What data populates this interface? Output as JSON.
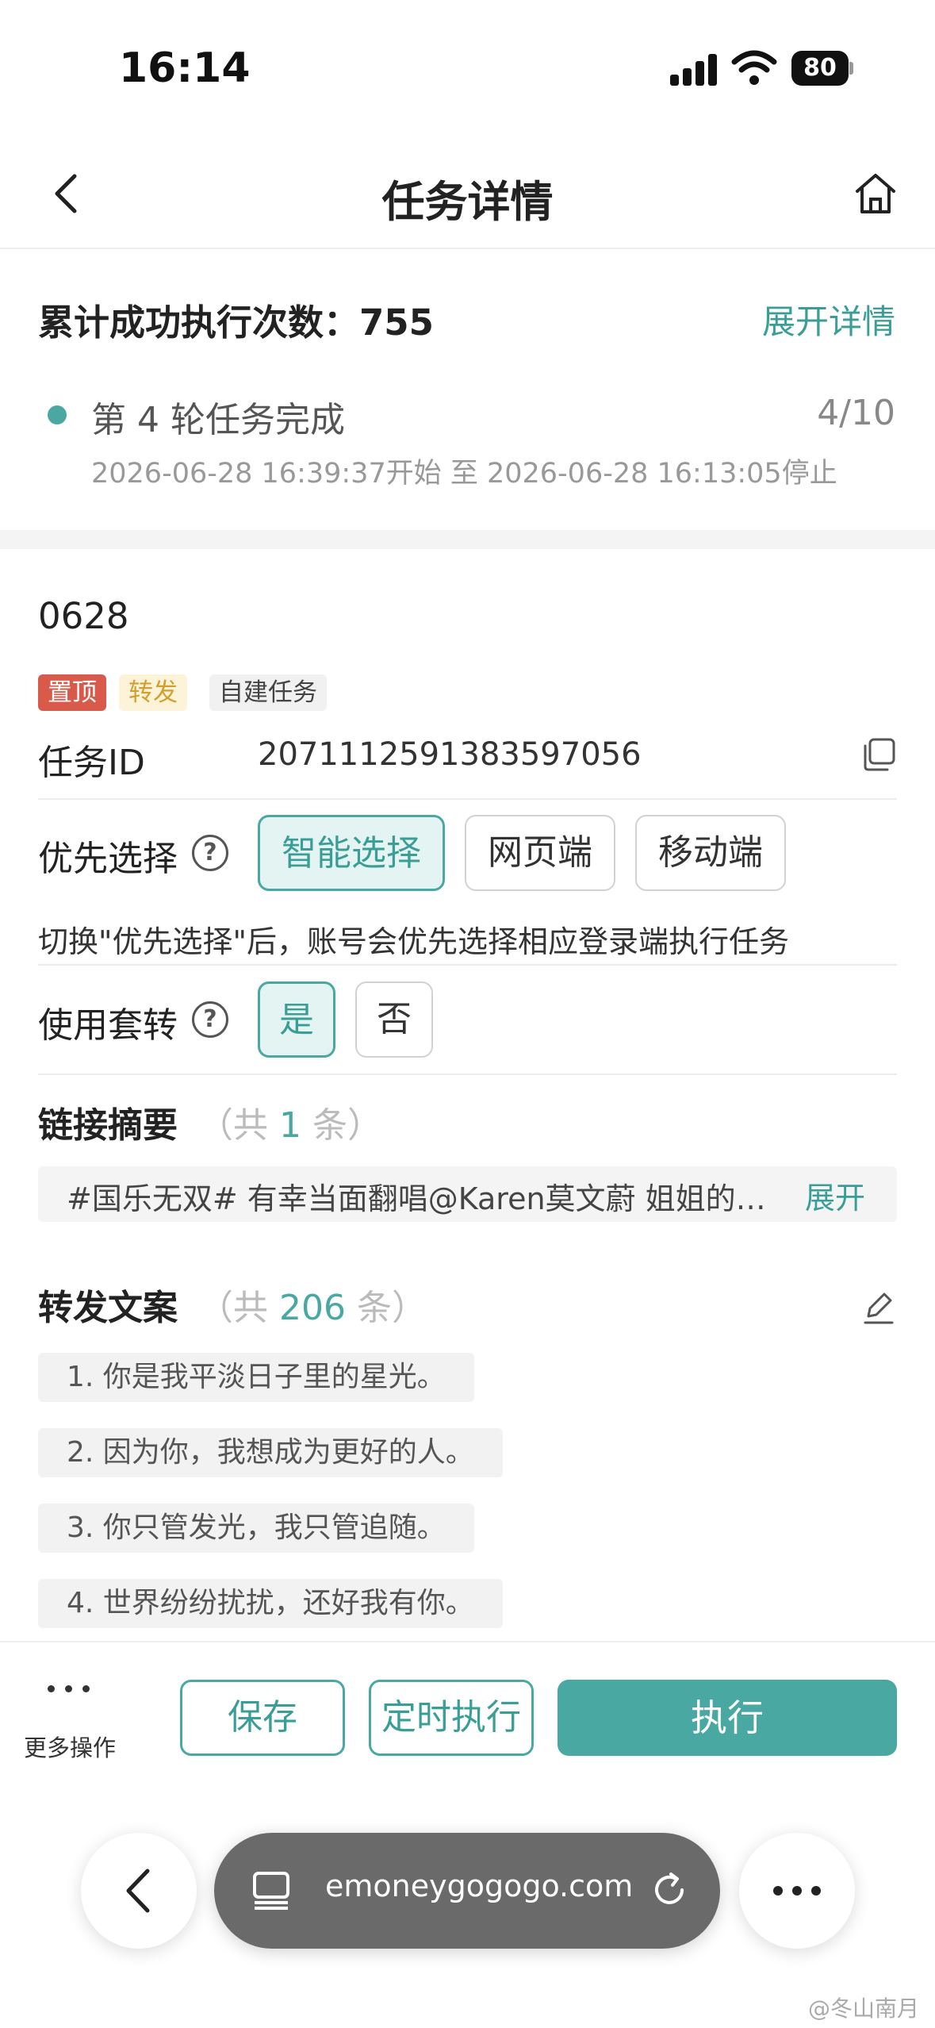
{
  "status_bar": {
    "time": "16:14",
    "battery": "80"
  },
  "nav": {
    "title": "任务详情"
  },
  "summary": {
    "total_label": "累计成功执行次数：755",
    "expand_label": "展开详情",
    "round_label": "第 4 轮任务完成",
    "progress": "4/10",
    "time_range": "2026-06-28 16:39:37开始 至 2026-06-28 16:13:05停止"
  },
  "task": {
    "name": "0628",
    "tags": {
      "top": "置顶",
      "forward": "转发",
      "self": "自建任务"
    },
    "id_label": "任务ID",
    "id_value": "2071112591383597056"
  },
  "priority": {
    "label": "优先选择",
    "help": "?",
    "options": [
      "智能选择",
      "网页端",
      "移动端"
    ],
    "selected": "智能选择",
    "hint": "切换\"优先选择\"后，账号会优先选择相应登录端执行任务"
  },
  "nested": {
    "label": "使用套转",
    "help": "?",
    "options": [
      "是",
      "否"
    ],
    "selected": "是"
  },
  "link_summary": {
    "label": "链接摘要",
    "count_prefix": "（共",
    "count": "1",
    "count_suffix": "条）",
    "text": "#国乐无双# 有幸当面翻唱@Karen莫文蔚 姐姐的歌...",
    "expand": "展开"
  },
  "forward_copy": {
    "label": "转发文案",
    "count_prefix": "（共",
    "count": "206",
    "count_suffix": "条）",
    "items": [
      "1. 你是我平淡日子里的星光。",
      "2. 因为你，我想成为更好的人。",
      "3. 你只管发光，我只管追随。",
      "4. 世界纷纷扰扰，还好我有你。"
    ]
  },
  "actions": {
    "more_dots": "···",
    "more_label": "更多操作",
    "save": "保存",
    "schedule": "定时执行",
    "execute": "执行"
  },
  "browser": {
    "url": "emoneygogogo.com"
  },
  "watermark": "@冬山南月",
  "colors": {
    "accent": "#4aa8a2",
    "tag_top": "#d9594a",
    "tag_forward": "#fdf3d8"
  }
}
